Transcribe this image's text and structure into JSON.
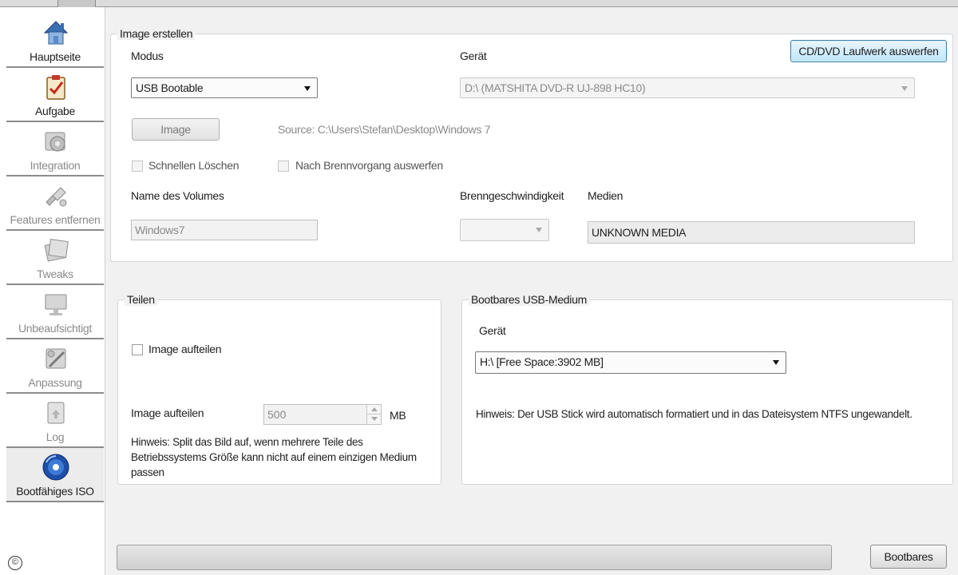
{
  "sidebar": {
    "items": [
      {
        "label": "Hauptseite",
        "icon": "home-icon"
      },
      {
        "label": "Aufgabe",
        "icon": "clipboard-icon"
      },
      {
        "label": "Integration",
        "icon": "integration-icon"
      },
      {
        "label": "Features entfernen",
        "icon": "remove-features-icon"
      },
      {
        "label": "Tweaks",
        "icon": "tweaks-icon"
      },
      {
        "label": "Unbeaufsichtigt",
        "icon": "unattended-icon"
      },
      {
        "label": "Anpassung",
        "icon": "customize-icon"
      },
      {
        "label": "Log",
        "icon": "log-icon"
      },
      {
        "label": "Bootfähiges ISO",
        "icon": "bootable-disc-icon"
      }
    ],
    "footer_symbol": "©"
  },
  "image_create": {
    "legend": "Image erstellen",
    "eject_button": "CD/DVD Laufwerk auswerfen",
    "mode_label": "Modus",
    "mode_value": "USB Bootable",
    "device_label": "Gerät",
    "device_value": "D:\\ (MATSHITA DVD-R   UJ-898   HC10)",
    "image_button": "Image",
    "source_text": "Source: C:\\Users\\Stefan\\Desktop\\Windows 7",
    "quick_erase_label": "Schnellen Löschen",
    "eject_after_label": "Nach Brennvorgang auswerfen",
    "volume_label": "Name des Volumes",
    "volume_value": "Windows7",
    "speed_label": "Brenngeschwindigkeit",
    "speed_value": "",
    "media_label": "Medien",
    "media_value": "UNKNOWN MEDIA"
  },
  "split": {
    "legend": "Teilen",
    "checkbox_label": "Image aufteilen",
    "size_label": "Image aufteilen",
    "size_value": "500",
    "unit": "MB",
    "hint": "Hinweis: Split das Bild auf, wenn mehrere Teile des Betriebssystems Größe kann nicht auf einem einzigen Medium passen"
  },
  "usb": {
    "legend": "Bootbares USB-Medium",
    "device_label": "Gerät",
    "device_value": "H:\\ [Free Space:3902 MB]",
    "hint": "Hinweis: Der USB Stick wird automatisch formatiert und in das Dateisystem NTFS ungewandelt."
  },
  "footer": {
    "bootable_button": "Bootbares"
  }
}
